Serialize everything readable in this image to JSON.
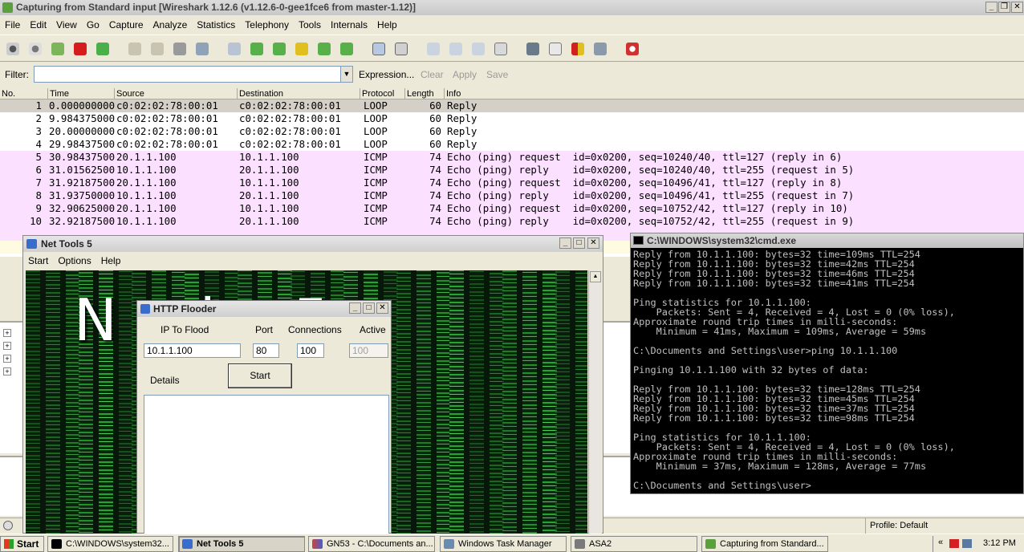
{
  "wireshark": {
    "title": "Capturing from Standard input   [Wireshark 1.12.6  (v1.12.6-0-gee1fce6 from master-1.12)]",
    "menu": [
      "File",
      "Edit",
      "View",
      "Go",
      "Capture",
      "Analyze",
      "Statistics",
      "Telephony",
      "Tools",
      "Internals",
      "Help"
    ],
    "filter": {
      "label": "Filter:",
      "value": "",
      "expression": "Expression...",
      "clear": "Clear",
      "apply": "Apply",
      "save": "Save"
    },
    "columns": [
      "No.",
      "Time",
      "Source",
      "Destination",
      "Protocol",
      "Length",
      "Info"
    ],
    "packets": [
      {
        "no": "1",
        "time": "0.000000000",
        "src": "c0:02:02:78:00:01",
        "dst": "c0:02:02:78:00:01",
        "proto": "LOOP",
        "len": "60",
        "info": "Reply",
        "kind": "sel"
      },
      {
        "no": "2",
        "time": "9.984375000",
        "src": "c0:02:02:78:00:01",
        "dst": "c0:02:02:78:00:01",
        "proto": "LOOP",
        "len": "60",
        "info": "Reply",
        "kind": "loop"
      },
      {
        "no": "3",
        "time": "20.00000000",
        "src": "c0:02:02:78:00:01",
        "dst": "c0:02:02:78:00:01",
        "proto": "LOOP",
        "len": "60",
        "info": "Reply",
        "kind": "loop"
      },
      {
        "no": "4",
        "time": "29.98437500",
        "src": "c0:02:02:78:00:01",
        "dst": "c0:02:02:78:00:01",
        "proto": "LOOP",
        "len": "60",
        "info": "Reply",
        "kind": "loop"
      },
      {
        "no": "5",
        "time": "30.98437500",
        "src": "20.1.1.100",
        "dst": "10.1.1.100",
        "proto": "ICMP",
        "len": "74",
        "info": "Echo (ping) request  id=0x0200, seq=10240/40, ttl=127 (reply in 6)",
        "kind": "icmp"
      },
      {
        "no": "6",
        "time": "31.01562500",
        "src": "10.1.1.100",
        "dst": "20.1.1.100",
        "proto": "ICMP",
        "len": "74",
        "info": "Echo (ping) reply    id=0x0200, seq=10240/40, ttl=255 (request in 5)",
        "kind": "icmp"
      },
      {
        "no": "7",
        "time": "31.92187500",
        "src": "20.1.1.100",
        "dst": "10.1.1.100",
        "proto": "ICMP",
        "len": "74",
        "info": "Echo (ping) request  id=0x0200, seq=10496/41, ttl=127 (reply in 8)",
        "kind": "icmp"
      },
      {
        "no": "8",
        "time": "31.93750000",
        "src": "10.1.1.100",
        "dst": "20.1.1.100",
        "proto": "ICMP",
        "len": "74",
        "info": "Echo (ping) reply    id=0x0200, seq=10496/41, ttl=255 (request in 7)",
        "kind": "icmp"
      },
      {
        "no": "9",
        "time": "32.90625000",
        "src": "20.1.1.100",
        "dst": "10.1.1.100",
        "proto": "ICMP",
        "len": "74",
        "info": "Echo (ping) request  id=0x0200, seq=10752/42, ttl=127 (reply in 10)",
        "kind": "icmp"
      },
      {
        "no": "10",
        "time": "32.92187500",
        "src": "10.1.1.100",
        "dst": "20.1.1.100",
        "proto": "ICMP",
        "len": "74",
        "info": "Echo (ping) reply    id=0x0200, seq=10752/42, ttl=255 (request in 9)",
        "kind": "icmp"
      }
    ],
    "status_profile": "Profile: Default"
  },
  "nettools": {
    "title": "Net Tools 5",
    "menu": [
      "Start",
      "Options",
      "Help"
    ],
    "logo": "N  ols 5"
  },
  "flooder": {
    "title": "HTTP Flooder",
    "ip_label": "IP To Flood",
    "port_label": "Port",
    "conn_label": "Connections",
    "active_label": "Active",
    "ip_value": "10.1.1.100",
    "port_value": "80",
    "conn_value": "100",
    "active_value": "100",
    "start_label": "Start",
    "details_label": "Details"
  },
  "cmd": {
    "title": "C:\\WINDOWS\\system32\\cmd.exe",
    "lines": [
      "Reply from 10.1.1.100: bytes=32 time=109ms TTL=254",
      "Reply from 10.1.1.100: bytes=32 time=42ms TTL=254",
      "Reply from 10.1.1.100: bytes=32 time=46ms TTL=254",
      "Reply from 10.1.1.100: bytes=32 time=41ms TTL=254",
      "",
      "Ping statistics for 10.1.1.100:",
      "    Packets: Sent = 4, Received = 4, Lost = 0 (0% loss),",
      "Approximate round trip times in milli-seconds:",
      "    Minimum = 41ms, Maximum = 109ms, Average = 59ms",
      "",
      "C:\\Documents and Settings\\user>ping 10.1.1.100",
      "",
      "Pinging 10.1.1.100 with 32 bytes of data:",
      "",
      "Reply from 10.1.1.100: bytes=32 time=128ms TTL=254",
      "Reply from 10.1.1.100: bytes=32 time=45ms TTL=254",
      "Reply from 10.1.1.100: bytes=32 time=37ms TTL=254",
      "Reply from 10.1.1.100: bytes=32 time=98ms TTL=254",
      "",
      "Ping statistics for 10.1.1.100:",
      "    Packets: Sent = 4, Received = 4, Lost = 0 (0% loss),",
      "Approximate round trip times in milli-seconds:",
      "    Minimum = 37ms, Maximum = 128ms, Average = 77ms",
      "",
      "C:\\Documents and Settings\\user>"
    ]
  },
  "taskbar": {
    "start": "Start",
    "tasks": [
      "C:\\WINDOWS\\system32...",
      "Net Tools 5",
      "GN53 - C:\\Documents an...",
      "Windows Task Manager",
      "ASA2",
      "Capturing from Standard..."
    ],
    "clock": "3:12 PM"
  }
}
